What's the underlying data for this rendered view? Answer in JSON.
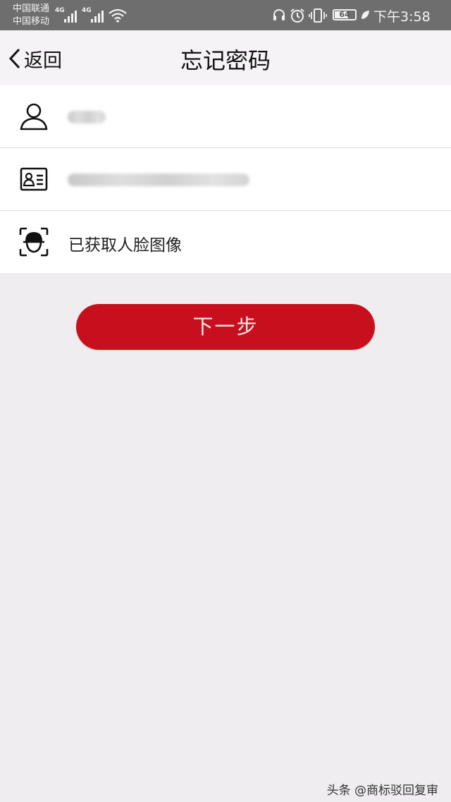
{
  "status_bar": {
    "carrier_1": "中国联通",
    "carrier_2": "中国移动",
    "network_1": "4G",
    "network_2": "4G",
    "battery": "64",
    "time": "下午3:58"
  },
  "nav": {
    "back_label": "返回",
    "title": "忘记密码"
  },
  "form": {
    "rows": [
      {
        "icon": "user-icon",
        "value": ""
      },
      {
        "icon": "id-card-icon",
        "value": ""
      },
      {
        "icon": "face-scan-icon",
        "value": "已获取人脸图像"
      }
    ]
  },
  "next_button": {
    "label": "下一步"
  },
  "watermark": "头条 @商标驳回复审",
  "colors": {
    "accent": "#c80f1e",
    "status_bar": "#6e6e6e",
    "background": "#efedef"
  }
}
